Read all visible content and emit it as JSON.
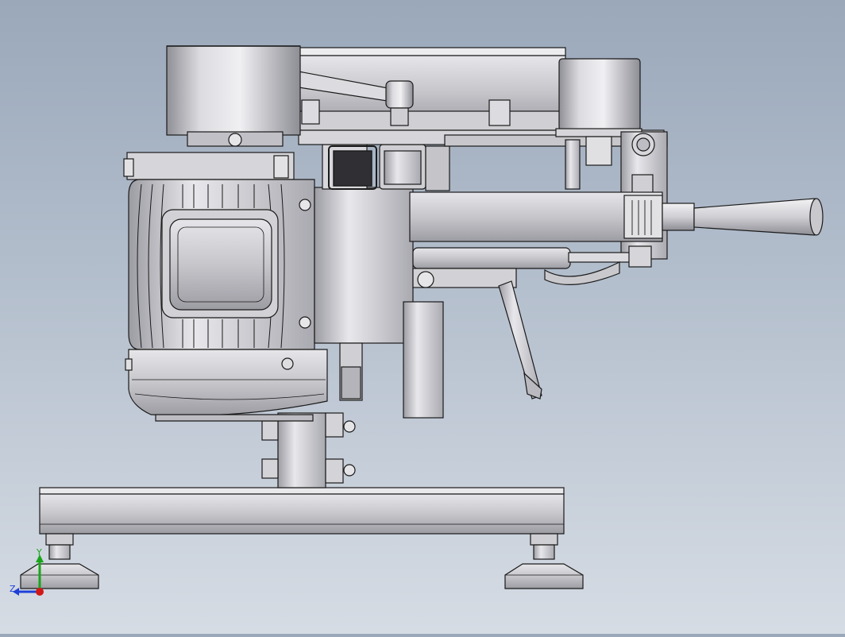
{
  "viewport": {
    "background_top": "#9aa8ba",
    "background_bottom": "#d6dce4",
    "part_color": "#c9c9cd",
    "edge_color": "#1a1a1a"
  },
  "triad": {
    "y_label": "Y",
    "z_label": "Z",
    "y_color": "#1aa51a",
    "z_color": "#1f3fd6",
    "x_color": "#d01818"
  }
}
